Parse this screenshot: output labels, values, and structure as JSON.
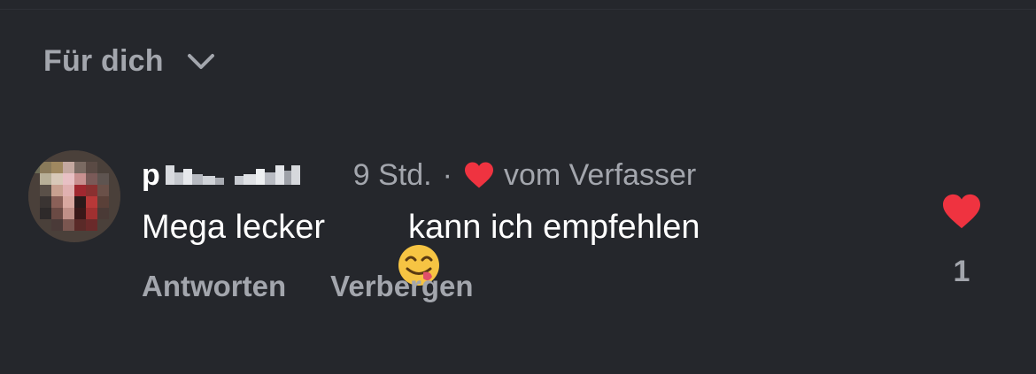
{
  "sort": {
    "label": "Für dich",
    "icon": "chevron-down-icon"
  },
  "comment": {
    "username_visible": "p",
    "timestamp": "9 Std.",
    "separator": "·",
    "liked_by_author_label": "vom Verfasser",
    "text_before": "Mega lecker",
    "emoji": "yum-face-emoji",
    "text_after": "kann ich empfehlen",
    "actions": {
      "reply": "Antworten",
      "hide": "Verbergen"
    },
    "like_count": "1",
    "liked": true
  },
  "colors": {
    "background": "#25272c",
    "muted_text": "#a3a6ad",
    "primary_text": "#ffffff",
    "heart": "#ef3340"
  }
}
